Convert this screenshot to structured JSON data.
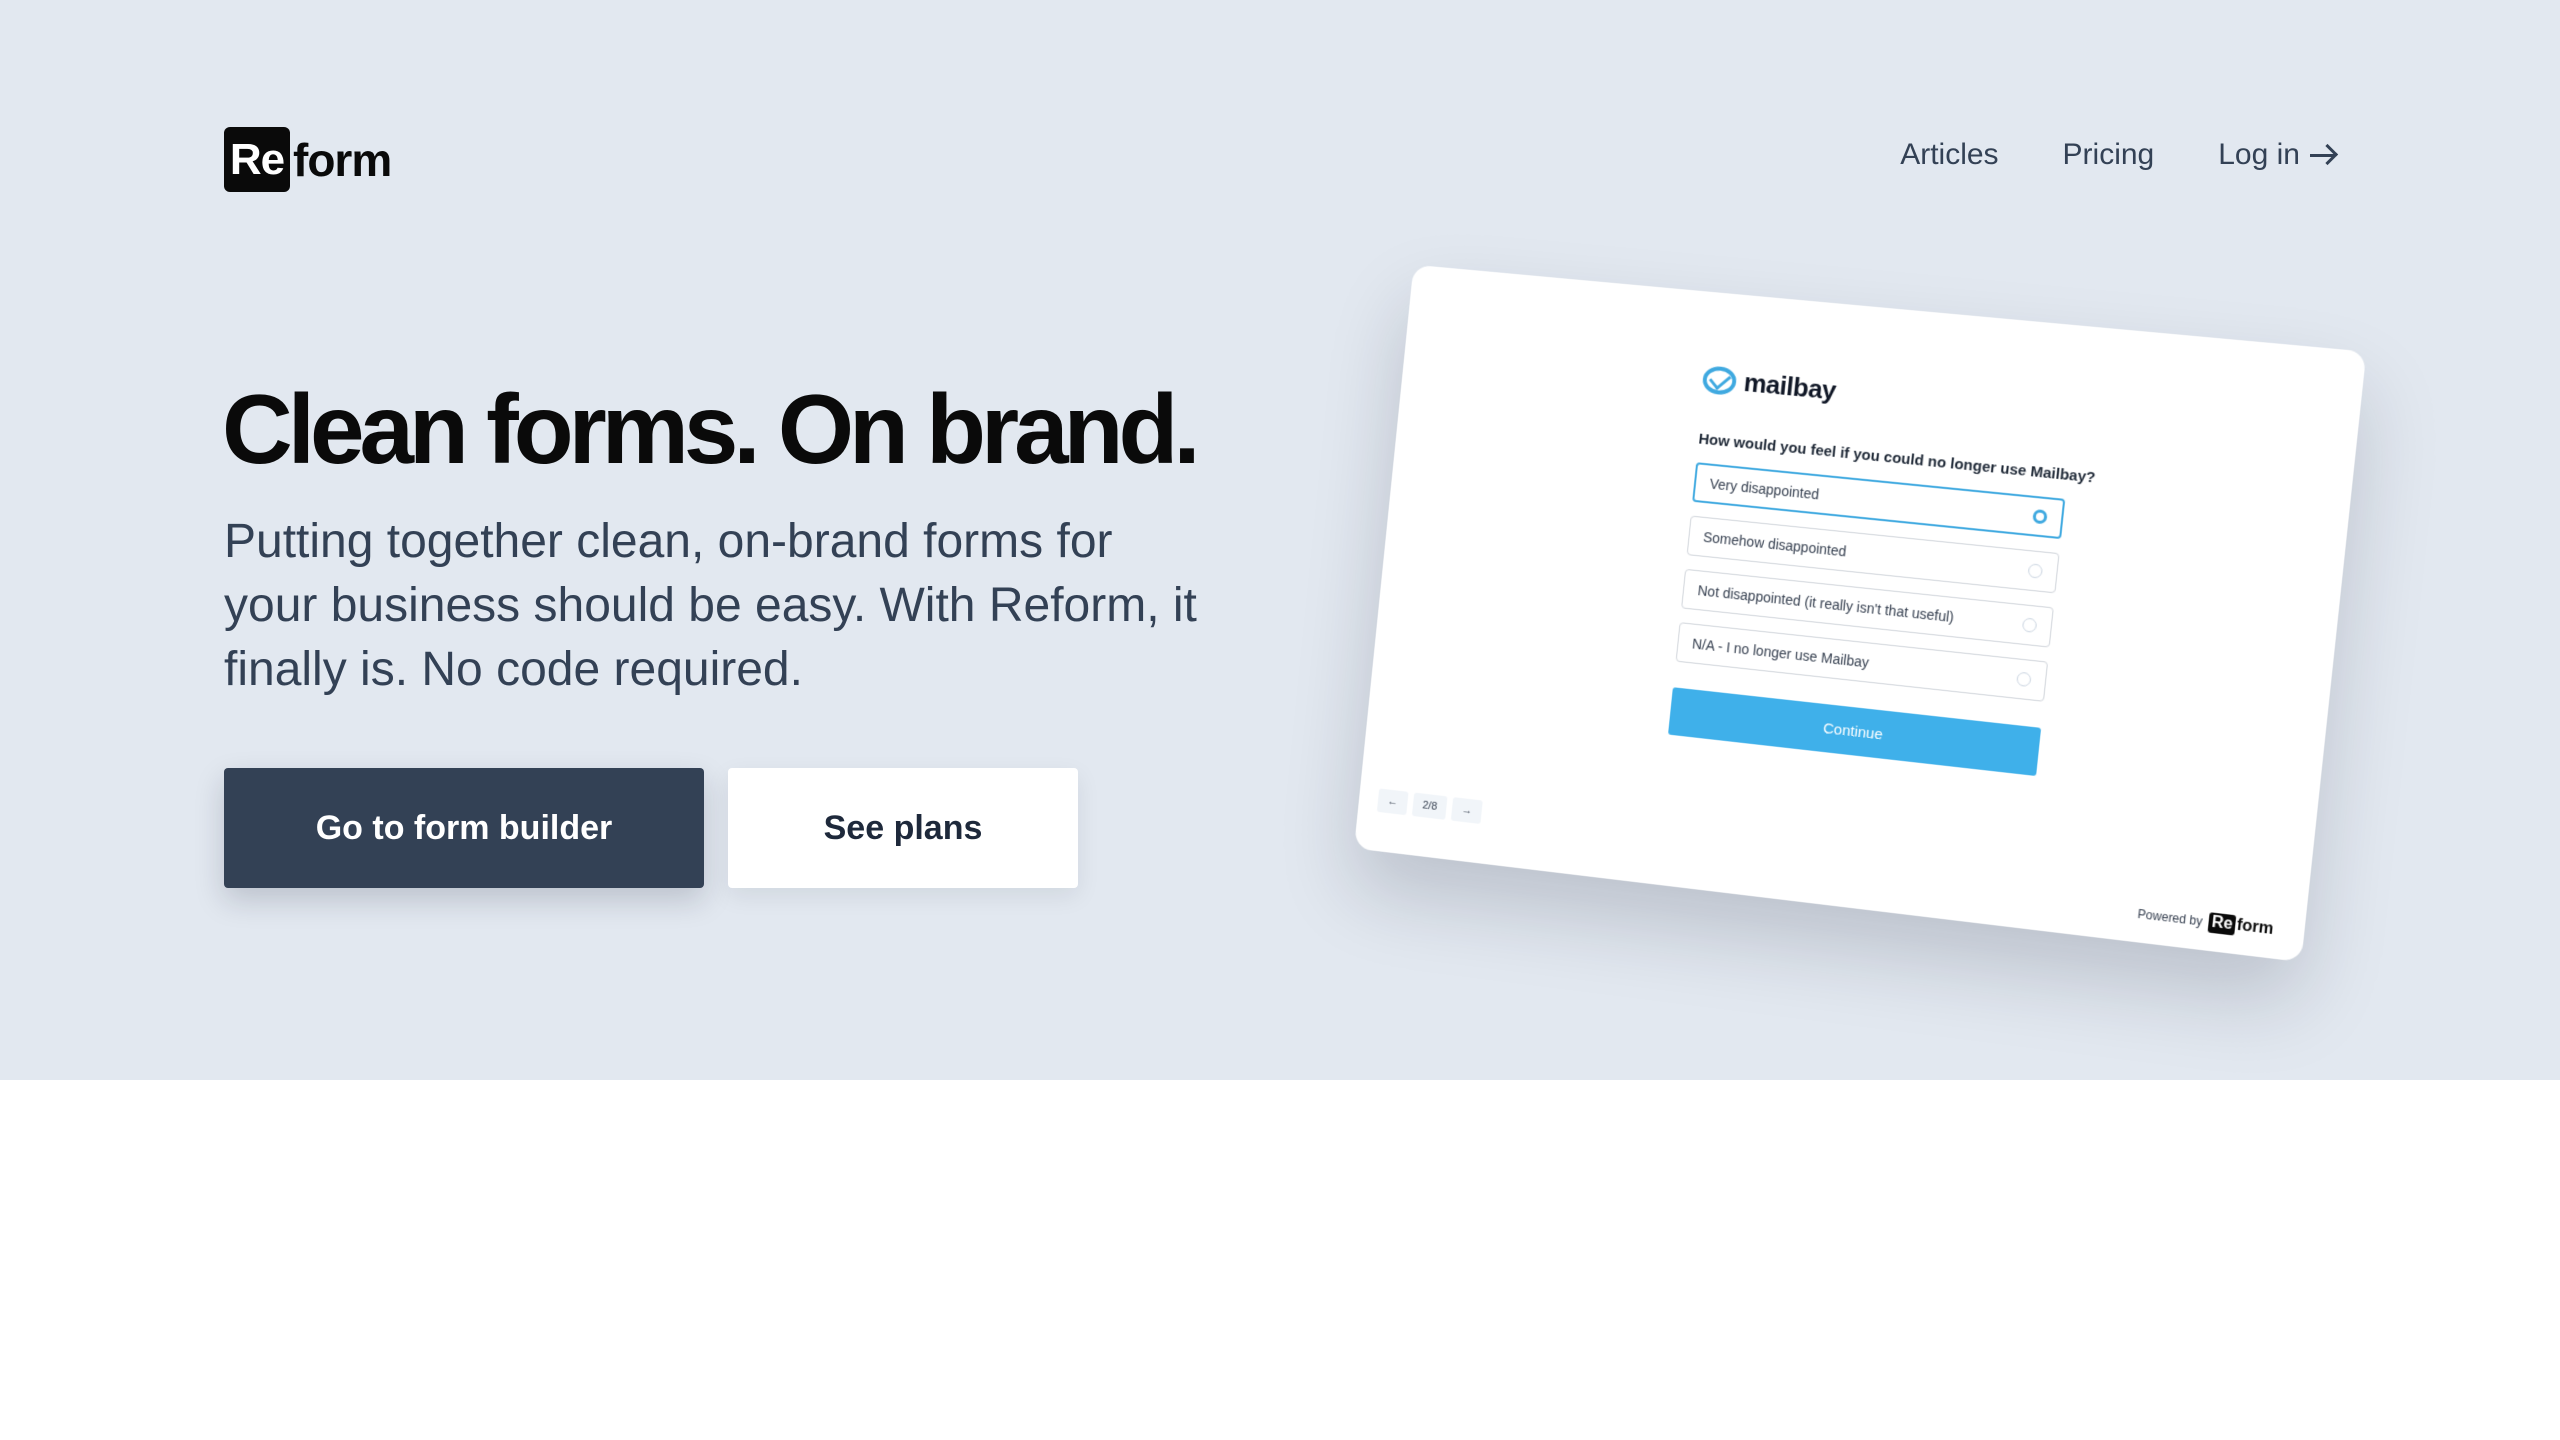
{
  "nav": {
    "logo_box": "Re",
    "logo_rest": "form",
    "links": [
      "Articles",
      "Pricing",
      "Log in"
    ]
  },
  "hero": {
    "headline": "Clean forms. On brand.",
    "subtext": "Putting together clean, on-brand forms for your business should be easy. With Reform, it finally is. No code required.",
    "primary_button": "Go to form builder",
    "secondary_button": "See plans"
  },
  "preview": {
    "brand": "mailbay",
    "question": "How would you feel if you could no longer use Mailbay?",
    "options": [
      "Very disappointed",
      "Somehow disappointed",
      "Not disappointed (it really isn't that useful)",
      "N/A - I no longer use Mailbay"
    ],
    "selected_index": 0,
    "continue_label": "Continue",
    "pager": {
      "prev": "←",
      "page": "2/8",
      "next": "→"
    },
    "powered_by": "Powered by",
    "powered_logo_box": "Re",
    "powered_logo_rest": "form"
  },
  "colors": {
    "hero_bg": "#e2e8f0",
    "primary_button": "#334155",
    "accent": "#3fb0ea"
  }
}
